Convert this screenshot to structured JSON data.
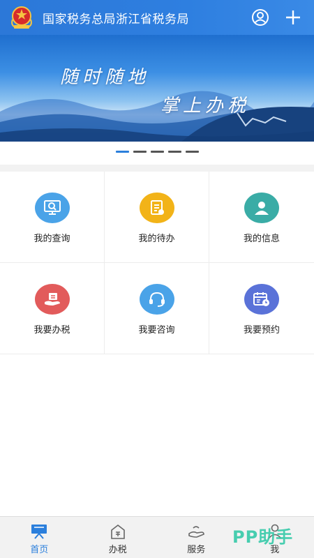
{
  "header": {
    "title": "国家税务总局浙江省税务局",
    "icons": {
      "logo": "tax-emblem-icon",
      "user": "user-icon",
      "add": "plus-icon"
    }
  },
  "banner": {
    "line1": "随时随地",
    "line2": "掌上办税",
    "slide_count": 5,
    "active_slide": 1
  },
  "menu": [
    {
      "label": "我的查询",
      "icon": "search-monitor-icon",
      "color": "#4aa3e8"
    },
    {
      "label": "我的待办",
      "icon": "todo-list-icon",
      "color": "#f2b318"
    },
    {
      "label": "我的信息",
      "icon": "person-icon",
      "color": "#3aaca6"
    },
    {
      "label": "我要办税",
      "icon": "tax-hand-icon",
      "color": "#e25b5b"
    },
    {
      "label": "我要咨询",
      "icon": "headset-icon",
      "color": "#4aa3e8"
    },
    {
      "label": "我要预约",
      "icon": "calendar-clock-icon",
      "color": "#5a72d8"
    }
  ],
  "nav": {
    "tabs": [
      {
        "label": "首页",
        "icon": "home-screen-icon",
        "active": true
      },
      {
        "label": "办税",
        "icon": "tax-house-icon",
        "active": false
      },
      {
        "label": "服务",
        "icon": "service-hand-icon",
        "active": false
      },
      {
        "label": "我",
        "icon": "me-icon",
        "active": false
      }
    ]
  },
  "watermark": "PP助手",
  "colors": {
    "primary": "#2b7fdc",
    "header_bg": "#2e7fe0"
  }
}
